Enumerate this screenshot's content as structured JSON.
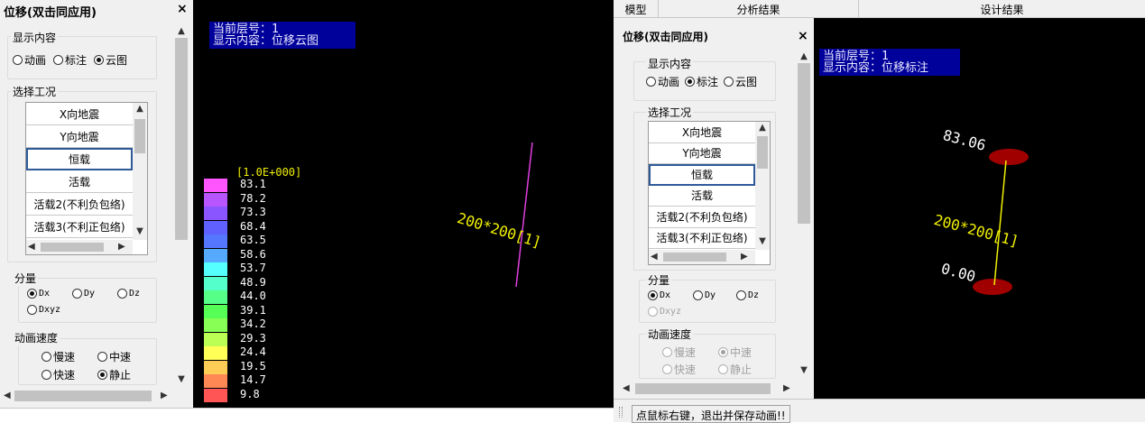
{
  "left": {
    "panel_title": "位移(双击同应用)",
    "close": "×",
    "display_group": {
      "label": "显示内容",
      "options": [
        "动画",
        "标注",
        "云图"
      ],
      "selected": 2
    },
    "case_group": {
      "label": "选择工况"
    },
    "cases": [
      "X向地震",
      "Y向地震",
      "恒载",
      "活载",
      "活载2(不利负包络)",
      "活载3(不利正包络)"
    ],
    "selected_case": 2,
    "component_group": {
      "label": "分量",
      "options": [
        "Dx",
        "Dy",
        "Dz",
        "Dxyz"
      ],
      "selected": 0
    },
    "speed_group": {
      "label": "动画速度",
      "options": [
        "慢速",
        "中速",
        "快速",
        "静止"
      ],
      "selected": 3
    },
    "arrows": {
      "up": "▲",
      "down": "▼",
      "left": "◀",
      "right": "▶"
    }
  },
  "left_view": {
    "info_line1": "当前层号：1",
    "info_line2": "显示内容：位移云图",
    "scale": "[1.0E+000]",
    "legend": [
      {
        "value": "83.1",
        "color": "#ff55ff"
      },
      {
        "value": "78.2",
        "color": "#b855ff"
      },
      {
        "value": "73.3",
        "color": "#8a55ff"
      },
      {
        "value": "68.4",
        "color": "#6060ff"
      },
      {
        "value": "63.5",
        "color": "#5577ff"
      },
      {
        "value": "58.6",
        "color": "#55aaff"
      },
      {
        "value": "53.7",
        "color": "#55ffff"
      },
      {
        "value": "48.9",
        "color": "#55ffcc"
      },
      {
        "value": "44.0",
        "color": "#55ff88"
      },
      {
        "value": "39.1",
        "color": "#55ff55"
      },
      {
        "value": "34.2",
        "color": "#88ff55"
      },
      {
        "value": "29.3",
        "color": "#bbff55"
      },
      {
        "value": "24.4",
        "color": "#ffff55"
      },
      {
        "value": "19.5",
        "color": "#ffcc55"
      },
      {
        "value": "14.7",
        "color": "#ff8855"
      },
      {
        "value": "9.8",
        "color": "#ff5555"
      }
    ],
    "member_label": "200*200[1]"
  },
  "tabs": [
    "模型",
    "分析结果",
    "设计结果"
  ],
  "right": {
    "panel_title": "位移(双击同应用)",
    "close": "×",
    "display_group": {
      "label": "显示内容",
      "options": [
        "动画",
        "标注",
        "云图"
      ],
      "selected": 1
    },
    "case_group": {
      "label": "选择工况"
    },
    "cases": [
      "X向地震",
      "Y向地震",
      "恒载",
      "活载",
      "活载2(不利负包络)",
      "活载3(不利正包络)"
    ],
    "selected_case": 2,
    "component_group": {
      "label": "分量",
      "options": [
        "Dx",
        "Dy",
        "Dz",
        "Dxyz"
      ],
      "selected": 0
    },
    "speed_group": {
      "label": "动画速度",
      "options": [
        "慢速",
        "中速",
        "快速",
        "静止"
      ],
      "selected": 1
    },
    "arrows": {
      "up": "▲",
      "down": "▼",
      "left": "◀",
      "right": "▶"
    }
  },
  "right_view": {
    "info_line1": "当前层号：1",
    "info_line2": "显示内容：位移标注",
    "top_value": "83.06",
    "bottom_value": "0.00",
    "member_label": "200*200[1]"
  },
  "status": {
    "message": "点鼠标右键，退出并保存动画!!"
  }
}
